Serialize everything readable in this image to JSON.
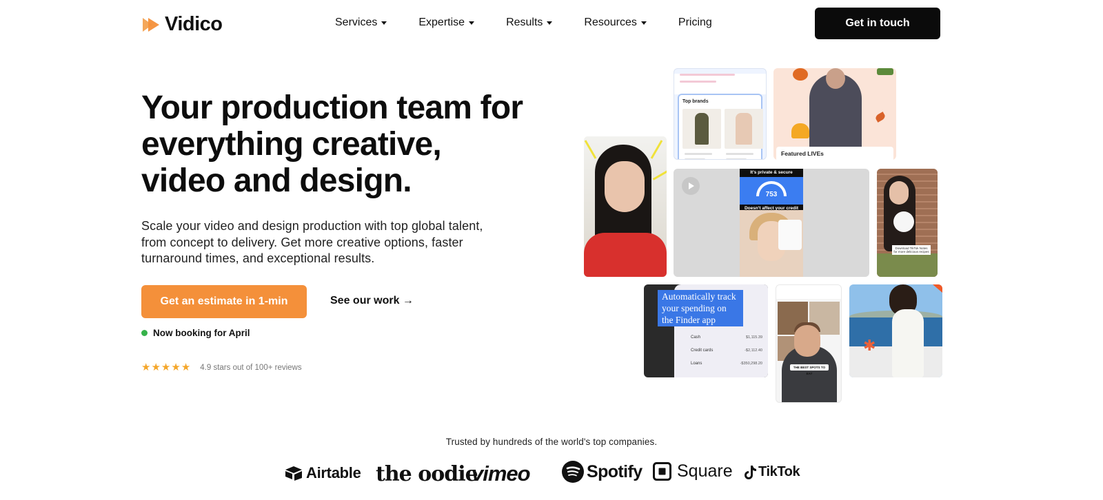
{
  "brand": {
    "name": "Vidico",
    "accent": "#f4903a",
    "dark": "#0b0b0b"
  },
  "nav": {
    "items": [
      {
        "label": "Services",
        "dropdown": true
      },
      {
        "label": "Expertise",
        "dropdown": true
      },
      {
        "label": "Results",
        "dropdown": true
      },
      {
        "label": "Resources",
        "dropdown": true
      },
      {
        "label": "Pricing",
        "dropdown": false
      }
    ],
    "cta": "Get in touch"
  },
  "hero": {
    "headline": "Your production team for everything creative, video and design.",
    "subcopy": "Scale your video and design production with top global talent, from concept to delivery. Get more creative options, faster turnaround times, and exceptional results.",
    "primary_cta": "Get an estimate in 1-min",
    "secondary_cta": "See our work →",
    "booking": "Now booking for April",
    "rating": {
      "stars": 5,
      "text": "4.9 stars out of 100+ reviews"
    }
  },
  "collage": {
    "top_brands": "Top brands",
    "featured": "Featured LIVEs",
    "credit_caption_top": "It's private & secure",
    "credit_score": "753",
    "credit_caption_bottom": "Doesn't affect your credit score",
    "dog_caption": "Download TikTok Notes for more delicious recipes",
    "finder_caption": "Automatically track your spending on the Finder app",
    "finder_rows": [
      {
        "label": "Cash",
        "value": "$1,115.39"
      },
      {
        "label": "Credit cards",
        "value": "-$2,112.40"
      },
      {
        "label": "Loans",
        "value": "-$350,298.20"
      }
    ],
    "food_caption": "THE BEST SPOTS TO EAT"
  },
  "trusted": {
    "text": "Trusted by hundreds of the world's top companies.",
    "logos": [
      "Airtable",
      "the oodie",
      "vimeo",
      "Spotify",
      "Square",
      "TikTok"
    ]
  }
}
